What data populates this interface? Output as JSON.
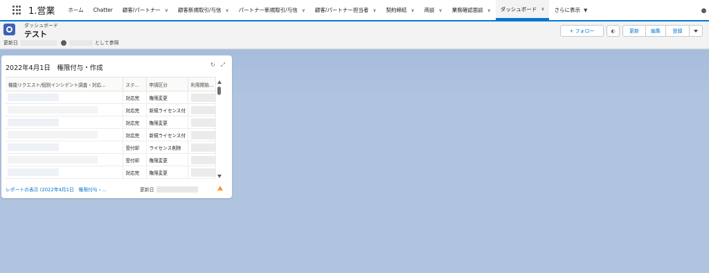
{
  "nav": {
    "app_name": "1.営業",
    "items": [
      {
        "label": "ホーム",
        "chevron": false,
        "active": false
      },
      {
        "label": "Chatter",
        "chevron": false,
        "active": false
      },
      {
        "label": "顧客/パートナー",
        "chevron": true,
        "active": false
      },
      {
        "label": "顧客新規取引/与信",
        "chevron": true,
        "active": false
      },
      {
        "label": "パートナー新規取引/与信",
        "chevron": true,
        "active": false
      },
      {
        "label": "顧客/パートナー担当者",
        "chevron": true,
        "active": false
      },
      {
        "label": "契約締結",
        "chevron": true,
        "active": false
      },
      {
        "label": "商談",
        "chevron": true,
        "active": false
      },
      {
        "label": "業務確認面談",
        "chevron": true,
        "active": false
      },
      {
        "label": "ダッシュボード",
        "chevron": true,
        "active": true
      }
    ],
    "more_label": "さらに表示"
  },
  "header": {
    "object_label": "ダッシュボード",
    "title": "テスト",
    "updated_label": "更新日",
    "view_as_label": "として参照"
  },
  "actions": {
    "follow": "+ フォロー",
    "refresh": "更新",
    "edit": "編集",
    "save": "登録"
  },
  "card": {
    "title": "2022年4月1日　権限付与・作成",
    "columns": [
      "機能リクエスト/個別インシデント調査・対応...",
      "ステ...",
      "申請区分",
      "利用開始..."
    ],
    "rows": [
      {
        "status": "対応完",
        "type": "権限変更"
      },
      {
        "status": "対応完",
        "type": "新規ライセンス付"
      },
      {
        "status": "対応完",
        "type": "権限変更"
      },
      {
        "status": "対応完",
        "type": "新規ライセンス付"
      },
      {
        "status": "受付却",
        "type": "ライセンス削除"
      },
      {
        "status": "受付却",
        "type": "権限変更"
      },
      {
        "status": "対応完",
        "type": "権限変更"
      }
    ],
    "footer_link": "レポートの表示 (2022年4月1日　権限付与・...",
    "footer_updated": "更新日"
  },
  "colors": {
    "brand": "#0176d3",
    "background": "#b0c4df",
    "warning": "#fe9339"
  },
  "icons": [
    "app-launcher-icon",
    "dashboard-icon",
    "info-icon",
    "refresh-icon",
    "expand-icon",
    "warning-icon"
  ]
}
